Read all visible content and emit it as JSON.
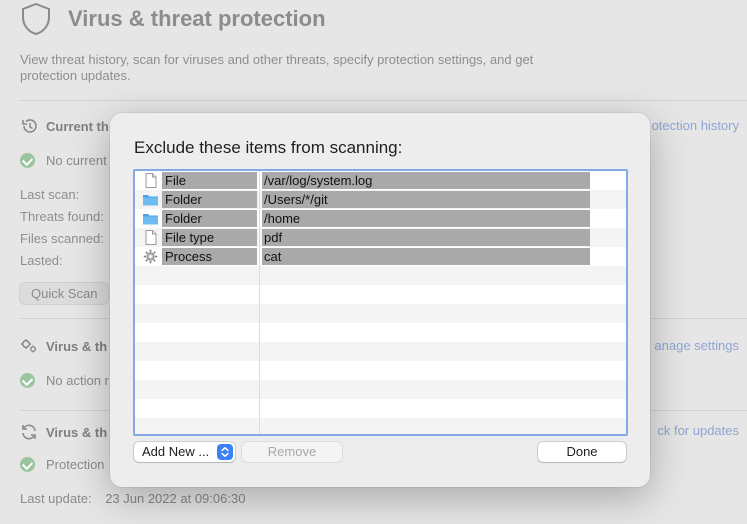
{
  "background": {
    "title": "Virus & threat protection",
    "description": "View threat history, scan for viruses and other threats, specify protection settings, and get protection updates.",
    "current_threats": {
      "heading": "Current th",
      "status": "No current",
      "link": "otection history"
    },
    "stats": {
      "last_scan": "Last scan:",
      "threats_found": "Threats found:",
      "files_scanned": "Files scanned:",
      "lasted": "Lasted:"
    },
    "quick_scan_label": "Quick Scan",
    "settings": {
      "heading": "Virus & th",
      "status": "No action r",
      "link": "anage settings"
    },
    "updates": {
      "heading": "Virus & th",
      "status": "Protection",
      "link": "ck for updates",
      "last_update_label": "Last update:",
      "last_update_value": "23 Jun 2022 at 09:06:30"
    },
    "colors": {
      "accent": "#3d82f5",
      "success": "#9cc59f",
      "link": "#8fa6d3"
    }
  },
  "dialog": {
    "title": "Exclude these items from scanning:",
    "exclusions": [
      {
        "type": "File",
        "icon": "document-icon",
        "path": "/var/log/system.log"
      },
      {
        "type": "Folder",
        "icon": "folder-icon",
        "path": "/Users/*/git"
      },
      {
        "type": "Folder",
        "icon": "folder-icon",
        "path": "/home"
      },
      {
        "type": "File type",
        "icon": "document-icon",
        "path": "pdf"
      },
      {
        "type": "Process",
        "icon": "gear-icon",
        "path": "cat"
      }
    ],
    "add_new_label": "Add New ...",
    "remove_label": "Remove",
    "done_label": "Done"
  }
}
